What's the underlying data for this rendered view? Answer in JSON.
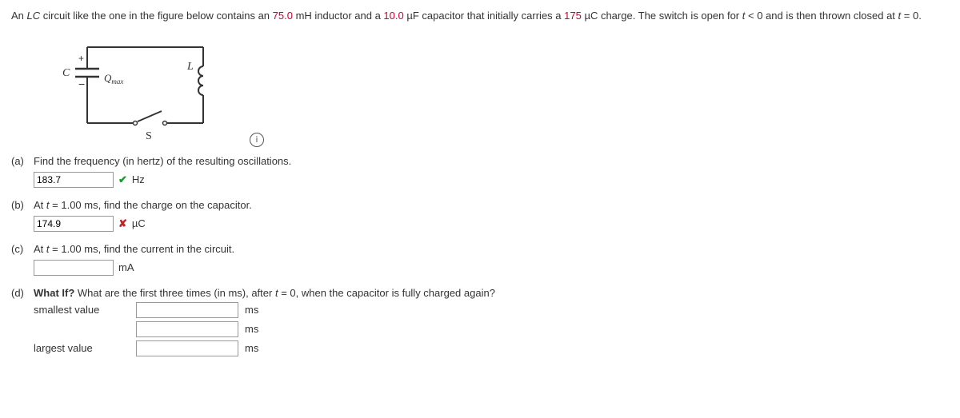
{
  "intro": {
    "t1": "An ",
    "lc": "LC",
    "t2": " circuit like the one in the figure below contains an ",
    "v1": "75.0",
    "u1": " mH inductor and a ",
    "v2": "10.0",
    "u2": " µF capacitor that initially carries a ",
    "v3": "175",
    "u3": " µC charge. The switch is open for ",
    "tlt": "t",
    "lt": " < 0 and is then thrown closed at ",
    "teq": "t",
    "eq": " = 0."
  },
  "fig": {
    "C": "C",
    "plus": "+",
    "minus": "−",
    "Q": "Q",
    "Qsub": "max",
    "L": "L",
    "S": "S",
    "info": "i"
  },
  "parts": {
    "a": {
      "label": "(a)",
      "prompt": "Find the frequency (in hertz) of the resulting oscillations.",
      "value": "183.7",
      "unit": "Hz",
      "state": "correct"
    },
    "b": {
      "label": "(b)",
      "p1": "At ",
      "t": "t",
      "p2": " = 1.00 ms, find the charge on the capacitor.",
      "value": "174.9",
      "unit": "µC",
      "state": "wrong"
    },
    "c": {
      "label": "(c)",
      "p1": "At ",
      "t": "t",
      "p2": " = 1.00 ms, find the current in the circuit.",
      "value": "",
      "unit": "mA"
    },
    "d": {
      "label": "(d)",
      "strong": "What If?",
      "p1": " What are the first three times (in ms), after ",
      "t": "t",
      "p2": " = 0, when the capacitor is fully charged again?",
      "smallest": "smallest value",
      "largest": "largest value",
      "unit": "ms",
      "v1": "",
      "v2": "",
      "v3": ""
    }
  }
}
